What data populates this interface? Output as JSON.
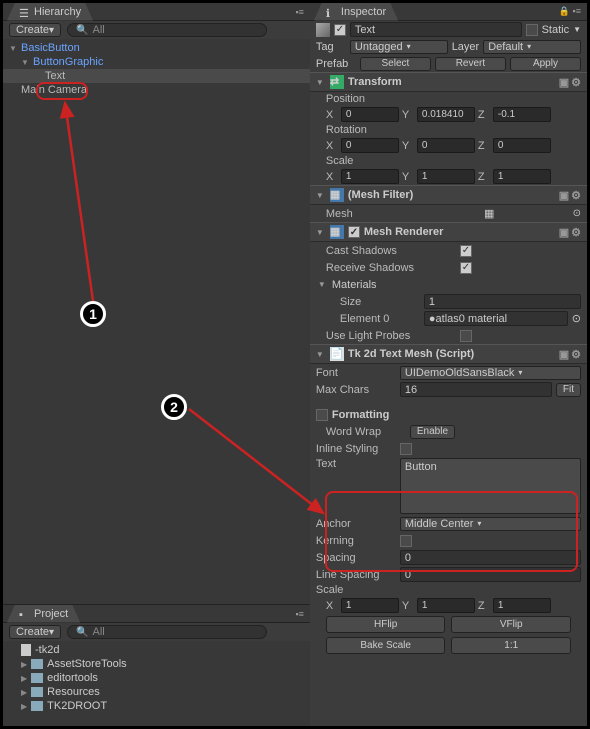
{
  "hierarchy": {
    "tab": "Hierarchy",
    "create": "Create",
    "search_placeholder": "All",
    "items": [
      "BasicButton",
      "ButtonGraphic",
      "Text",
      "Main Camera"
    ]
  },
  "project": {
    "tab": "Project",
    "create": "Create",
    "search_placeholder": "All",
    "items": [
      "-tk2d",
      "AssetStoreTools",
      "editortools",
      "Resources",
      "TK2DROOT"
    ]
  },
  "inspector": {
    "tab": "Inspector",
    "name": "Text",
    "static": "Static",
    "tag_label": "Tag",
    "tag_value": "Untagged",
    "layer_label": "Layer",
    "layer_value": "Default",
    "prefab_label": "Prefab",
    "prefab_select": "Select",
    "prefab_revert": "Revert",
    "prefab_apply": "Apply"
  },
  "transform": {
    "title": "Transform",
    "position": "Position",
    "rotation": "Rotation",
    "scale": "Scale",
    "pos": {
      "x": "0",
      "y": "0.018410",
      "z": "-0.1"
    },
    "rot": {
      "x": "0",
      "y": "0",
      "z": "0"
    },
    "scl": {
      "x": "1",
      "y": "1",
      "z": "1"
    }
  },
  "meshfilter": {
    "title": "(Mesh Filter)",
    "mesh_label": "Mesh",
    "mesh_value": ""
  },
  "meshrenderer": {
    "title": "Mesh Renderer",
    "cast": "Cast Shadows",
    "receive": "Receive Shadows",
    "materials": "Materials",
    "size_label": "Size",
    "size_value": "1",
    "el0_label": "Element 0",
    "el0_value": "atlas0 material",
    "lightprobes": "Use Light Probes"
  },
  "textmesh": {
    "title": "Tk 2d Text Mesh (Script)",
    "font_label": "Font",
    "font_value": "UIDemoOldSansBlack",
    "maxchars_label": "Max Chars",
    "maxchars_value": "16",
    "fit": "Fit",
    "formatting": "Formatting",
    "wordwrap_label": "Word Wrap",
    "wordwrap_btn": "Enable",
    "inline": "Inline Styling",
    "text_label": "Text",
    "text_value": "Button",
    "anchor_label": "Anchor",
    "anchor_value": "Middle Center",
    "kerning_label": "Kerning",
    "spacing_label": "Spacing",
    "spacing_value": "0",
    "linespacing_label": "Line Spacing",
    "linespacing_value": "0",
    "scale_label": "Scale",
    "scale": {
      "x": "1",
      "y": "1",
      "z": "1"
    },
    "hflip": "HFlip",
    "vflip": "VFlip",
    "bake": "Bake Scale",
    "ratio": "1:1"
  },
  "callouts": {
    "one": "1",
    "two": "2"
  },
  "axis": {
    "x": "X",
    "y": "Y",
    "z": "Z"
  }
}
